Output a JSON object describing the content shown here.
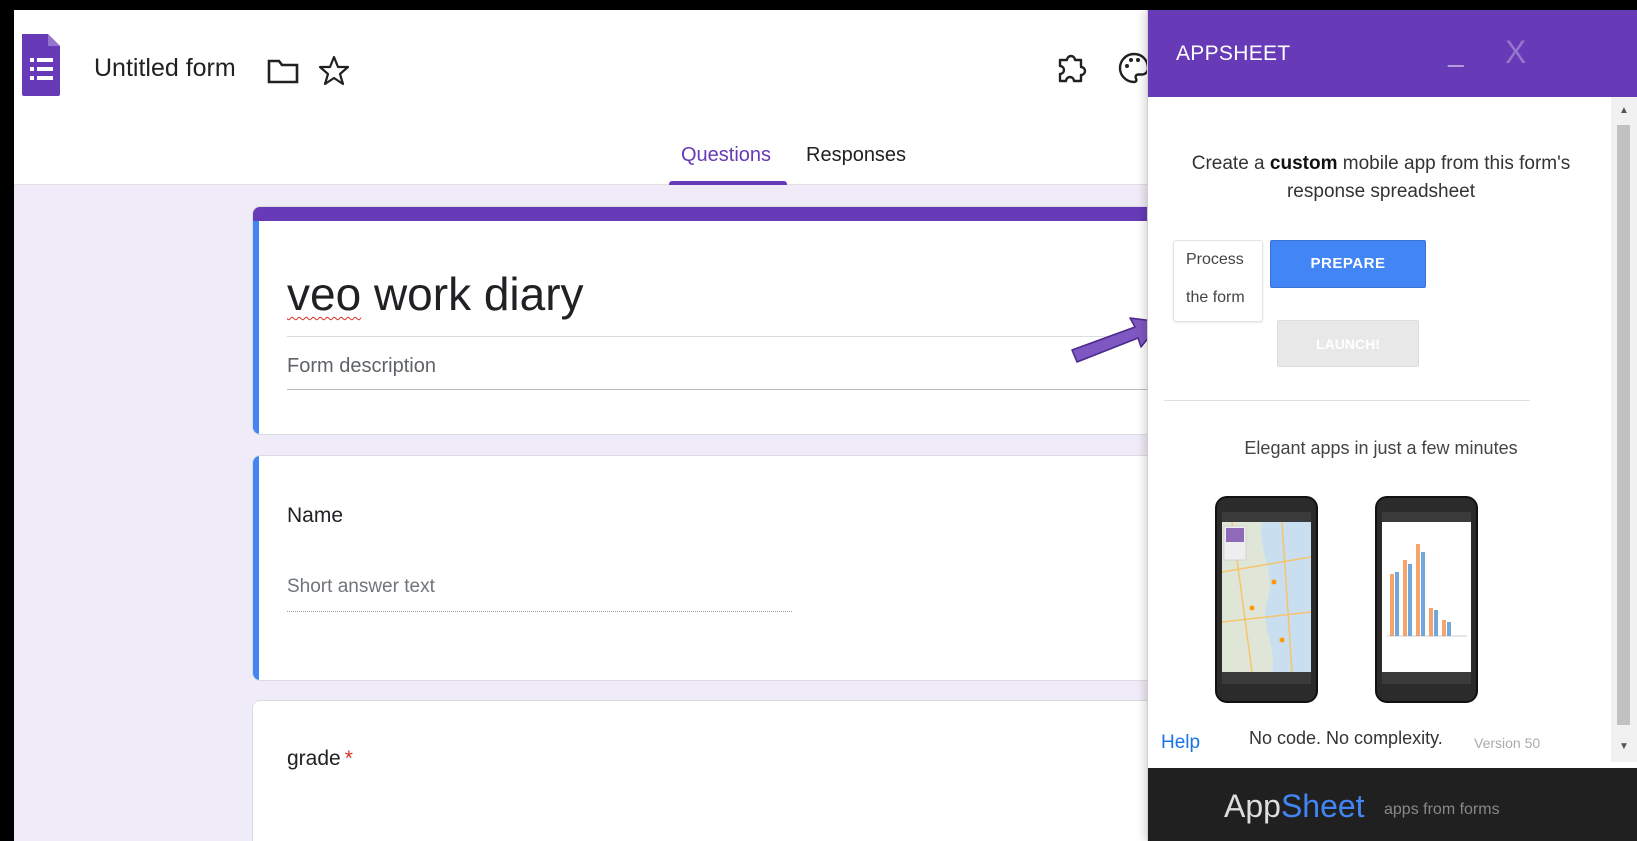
{
  "header": {
    "form_title": "Untitled form",
    "tabs": [
      {
        "label": "Questions",
        "active": true
      },
      {
        "label": "Responses",
        "active": false
      }
    ]
  },
  "form": {
    "name_word1": "veo",
    "name_rest": " work diary",
    "description_placeholder": "Form description"
  },
  "questions": [
    {
      "title": "Name",
      "answer_placeholder": "Short answer text",
      "required": false
    },
    {
      "title": "grade",
      "required": true,
      "required_mark": "*"
    }
  ],
  "appsheet": {
    "title": "APPSHEET",
    "minimize_label": "_",
    "close_label": "X",
    "intro_pre": "Create a ",
    "intro_bold": "custom",
    "intro_post": " mobile app from this form's response spreadsheet",
    "step_line1": "Process",
    "step_line2": "the form",
    "prepare_label": "PREPARE",
    "launch_label": "LAUNCH!",
    "tagline": "Elegant apps in just a few minutes",
    "help_label": "Help",
    "footer_text": "No code. No complexity.",
    "version": "Version 50",
    "brand_app": "App",
    "brand_sheet": "Sheet",
    "brand_sub": "apps from forms"
  },
  "colors": {
    "accent_purple": "#673ab7",
    "focus_blue": "#4285f4",
    "required_red": "#d93025",
    "page_bg": "#f0ebf8"
  }
}
